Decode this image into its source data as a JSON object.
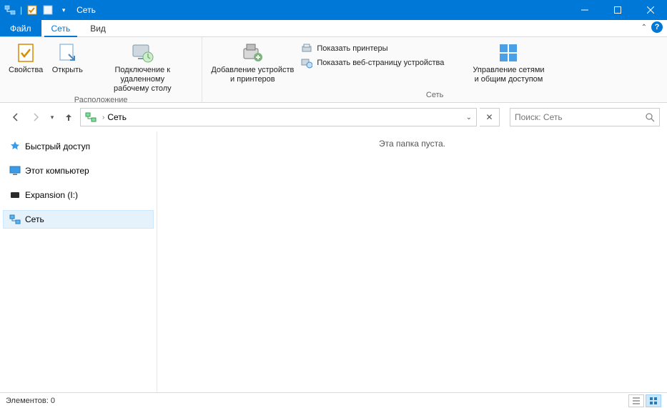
{
  "window": {
    "title": "Сеть"
  },
  "tabs": {
    "file": "Файл",
    "network": "Сеть",
    "view": "Вид"
  },
  "ribbon": {
    "group_location": {
      "label": "Расположение",
      "properties": "Свойства",
      "open": "Открыть",
      "rdp": "Подключение к удаленному\nрабочему столу"
    },
    "group_add": {
      "add_devices": "Добавление устройств\nи принтеров"
    },
    "group_network": {
      "label": "Сеть",
      "show_printers": "Показать принтеры",
      "show_web": "Показать веб-страницу устройства",
      "manage": "Управление сетями\nи общим доступом"
    }
  },
  "address": {
    "crumb": "Сеть"
  },
  "search": {
    "placeholder": "Поиск: Сеть"
  },
  "nav": {
    "quick_access": "Быстрый доступ",
    "this_pc": "Этот компьютер",
    "expansion": "Expansion (I:)",
    "network": "Сеть"
  },
  "main": {
    "empty": "Эта папка пуста."
  },
  "status": {
    "items": "Элементов: 0"
  }
}
